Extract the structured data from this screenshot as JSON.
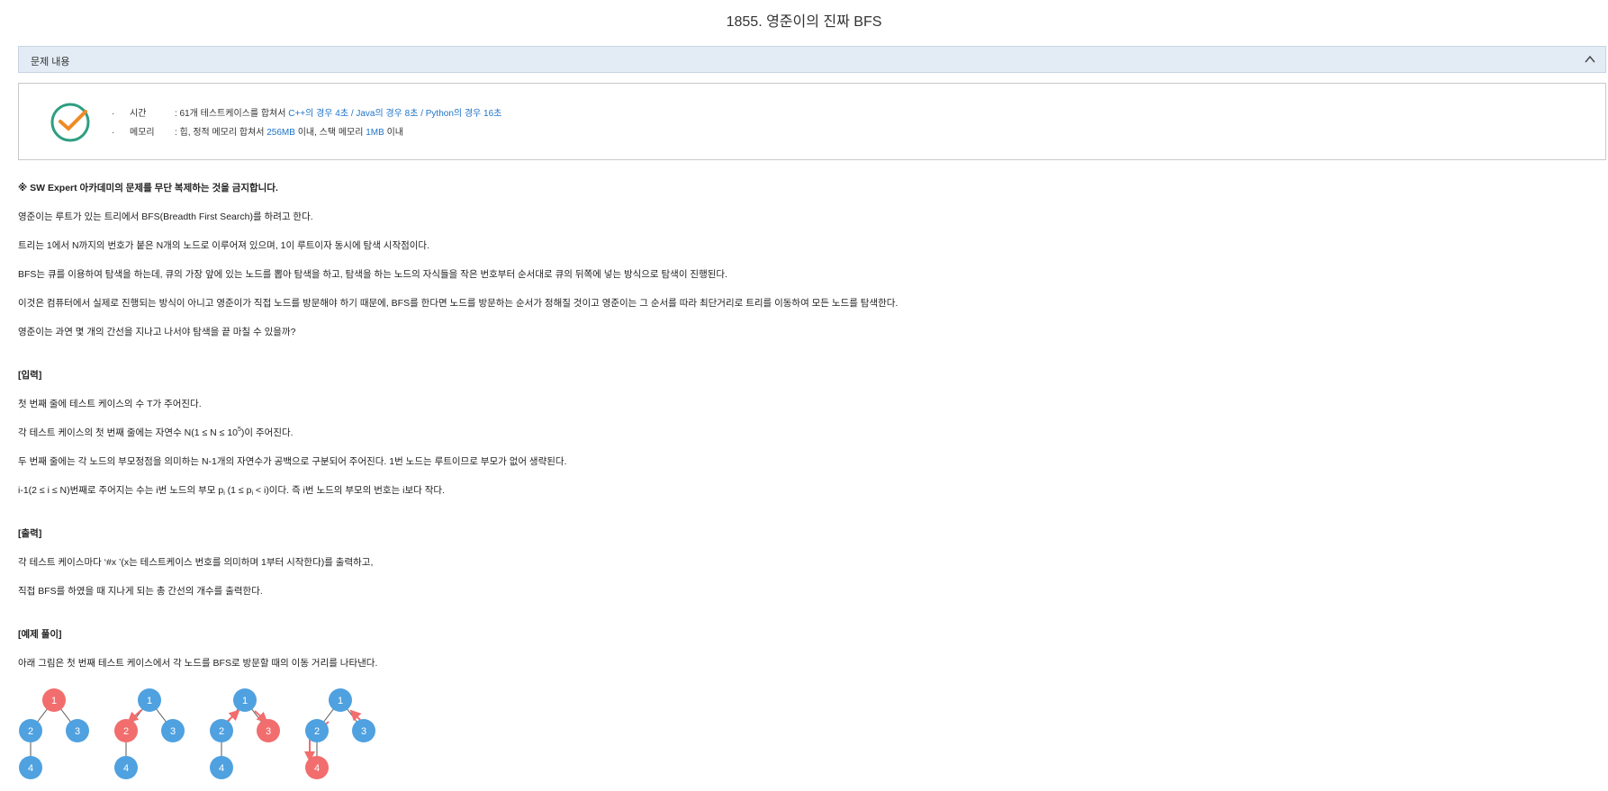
{
  "page": {
    "title": "1855. 영준이의 진짜 BFS"
  },
  "section": {
    "label": "문제 내용"
  },
  "info": {
    "time": {
      "key": "시간",
      "prefix": ": 61개 테스트케이스를 합쳐서 ",
      "highlight": "C++의 경우 4초 / Java의 경우 8초 / Python의 경우 16초"
    },
    "memory": {
      "key": "메모리",
      "prefix": ": 힙, 정적 메모리 합쳐서 ",
      "hl1": "256MB",
      "mid": " 이내, 스택 메모리 ",
      "hl2": "1MB",
      "suffix": " 이내"
    }
  },
  "content": {
    "notice": "※ SW Expert 아카데미의 문제를 무단 복제하는 것을 금지합니다.",
    "p1": "영준이는 루트가 있는 트리에서 BFS(Breadth First Search)를 하려고 한다.",
    "p2": "트리는 1에서 N까지의 번호가 붙은 N개의 노드로 이루어져 있으며, 1이 루트이자 동시에 탐색 시작점이다.",
    "p3": "BFS는 큐를 이용하여 탐색을 하는데, 큐의 가장 앞에 있는 노드를 뽑아 탐색을 하고, 탐색을 하는 노드의 자식들을 작은 번호부터 순서대로 큐의 뒤쪽에 넣는 방식으로 탐색이 진행된다.",
    "p4": "이것은 컴퓨터에서 실제로 진행되는 방식이 아니고 영준이가 직접 노드를 방문해야 하기 때문에, BFS를 한다면 노드를 방문하는 순서가 정해질 것이고 영준이는 그 순서를 따라 최단거리로 트리를 이동하여 모든 노드를 탐색한다.",
    "p5": "영준이는 과연 몇 개의 간선을 지나고 나서야 탐색을 끝 마칠 수 있을까?",
    "input_heading": "[입력]",
    "in1": "첫 번째 줄에 테스트 케이스의 수 T가 주어진다.",
    "in2_pre": "각 테스트 케이스의 첫 번째 줄에는 자연수 N(1 ≤ N ≤ 10",
    "in2_sup": "5",
    "in2_post": ")이 주어진다.",
    "in3": "두 번째 줄에는 각 노드의 부모정점을 의미하는 N-1개의 자연수가 공백으로 구분되어 주어진다. 1번 노드는 루트이므로 부모가 없어 생략된다.",
    "in4_a": "i-1(2 ≤ i ≤ N)번째로 주어지는 수는 i번 노드의 부모 p",
    "in4_sub1": "i",
    "in4_b": " (1 ≤ p",
    "in4_sub2": "i",
    "in4_c": " < i)이다. 즉 i번 노드의 부모의 번호는 i보다 작다.",
    "output_heading": "[출력]",
    "out1": "각 테스트 케이스마다 ‘#x ’(x는 테스트케이스 번호를 의미하며 1부터 시작한다)를 출력하고,",
    "out2": "직접 BFS를 하였을 때 지나게 되는 총 간선의 개수를 출력한다.",
    "example_heading": "[예제 풀이]",
    "ex1": "아래 그림은 첫 번째 테스트 케이스에서 각 노드를 BFS로 방문할 때의 이동 거리를 나타낸다."
  },
  "trees": {
    "colors": {
      "normal": "#4fa1e0",
      "active": "#f26d6d",
      "arrow": "#f26d6d",
      "edge": "#555555"
    },
    "steps": [
      {
        "active": "1",
        "labels": [
          "1",
          "2",
          "3",
          "4"
        ]
      },
      {
        "active": "2",
        "labels": [
          "1",
          "2",
          "3",
          "4"
        ]
      },
      {
        "active": "3",
        "labels": [
          "1",
          "2",
          "3",
          "4"
        ]
      },
      {
        "active": "4",
        "labels": [
          "1",
          "2",
          "3",
          "4"
        ]
      }
    ]
  }
}
